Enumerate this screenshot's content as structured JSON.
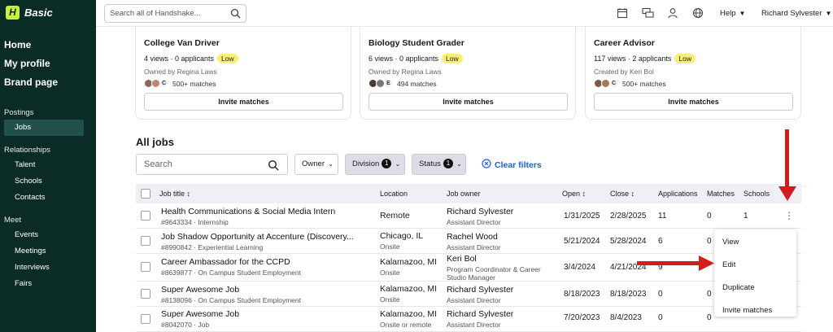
{
  "sidebar": {
    "logo_letter": "H",
    "logo_text": "Basic",
    "main": [
      "Home",
      "My profile",
      "Brand page"
    ],
    "groups": [
      {
        "label": "Postings",
        "items": [
          "Jobs"
        ]
      },
      {
        "label": "Relationships",
        "items": [
          "Talent",
          "Schools",
          "Contacts"
        ]
      },
      {
        "label": "Meet",
        "items": [
          "Events",
          "Meetings",
          "Interviews",
          "Fairs"
        ]
      }
    ],
    "active": "Jobs"
  },
  "header": {
    "search_placeholder": "Search all of Handshake...",
    "help": "Help",
    "user": "Richard Sylvester"
  },
  "cards": [
    {
      "title": "College Van Driver",
      "views": "4 views · 0 applicants",
      "badge": "Low",
      "owner": "Owned by Regina Laws",
      "matches": "500+ matches",
      "button": "Invite matches"
    },
    {
      "title": "Biology Student Grader",
      "views": "6 views · 0 applicants",
      "badge": "Low",
      "owner": "Owned by Regina Laws",
      "matches": "494 matches",
      "button": "Invite matches"
    },
    {
      "title": "Career Advisor",
      "views": "117 views · 2 applicants",
      "badge": "Low",
      "owner": "Created by Keri Bol",
      "matches": "500+ matches",
      "button": "Invite matches"
    }
  ],
  "jobs": {
    "heading": "All jobs",
    "search_placeholder": "Search",
    "filters": {
      "owner": "Owner",
      "division": "Division",
      "division_count": "1",
      "status": "Status",
      "status_count": "1"
    },
    "clear_filters": "Clear filters",
    "columns": [
      "Job title",
      "Location",
      "Job owner",
      "Open",
      "Close",
      "Applications",
      "Matches",
      "Schools"
    ],
    "rows": [
      {
        "title": "Health Communications & Social Media Intern",
        "sub": "#9643334 · Internship",
        "location": "Remote",
        "location_sub": "",
        "owner": "Richard Sylvester",
        "owner_role": "Assistant Director",
        "owner_role2": "",
        "open": "1/31/2025",
        "close": "2/28/2025",
        "applications": "11",
        "matches": "0",
        "schools": "1"
      },
      {
        "title": "Job Shadow Opportunity at Accenture (Discovery...",
        "sub": "#8990842 · Experiential Learning",
        "location": "Chicago, IL",
        "location_sub": "Onsite",
        "owner": "Rachel Wood",
        "owner_role": "Assistant Director",
        "owner_role2": "",
        "open": "5/21/2024",
        "close": "5/28/2024",
        "applications": "6",
        "matches": "0",
        "schools": ""
      },
      {
        "title": "Career Ambassador for the CCPD",
        "sub": "#8639877 · On Campus Student Employment",
        "location": "Kalamazoo, MI",
        "location_sub": "Onsite",
        "owner": "Keri Bol",
        "owner_role": "Program Coordinator & Career",
        "owner_role2": "Studio Manager",
        "open": "3/4/2024",
        "close": "4/21/2024",
        "applications": "9",
        "matches": "",
        "schools": ""
      },
      {
        "title": "Super Awesome Job",
        "sub": "#8138096 · On Campus Student Employment",
        "location": "Kalamazoo, MI",
        "location_sub": "Onsite",
        "owner": "Richard Sylvester",
        "owner_role": "Assistant Director",
        "owner_role2": "",
        "open": "8/18/2023",
        "close": "8/18/2023",
        "applications": "0",
        "matches": "0",
        "schools": ""
      },
      {
        "title": "Super Awesome Job",
        "sub": "#8042070 · Job",
        "location": "Kalamazoo, MI",
        "location_sub": "Onsite or remote",
        "owner": "Richard Sylvester",
        "owner_role": "Assistant Director",
        "owner_role2": "",
        "open": "7/20/2023",
        "close": "8/4/2023",
        "applications": "0",
        "matches": "0",
        "schools": ""
      }
    ]
  },
  "menu": [
    "View",
    "Edit",
    "Duplicate",
    "Invite matches"
  ],
  "colors": {
    "sidebar": "#0b2b26",
    "accent": "#c8f13a",
    "badge": "#f7ef77",
    "link": "#1f5ed6",
    "arrow": "#d21d1d"
  }
}
